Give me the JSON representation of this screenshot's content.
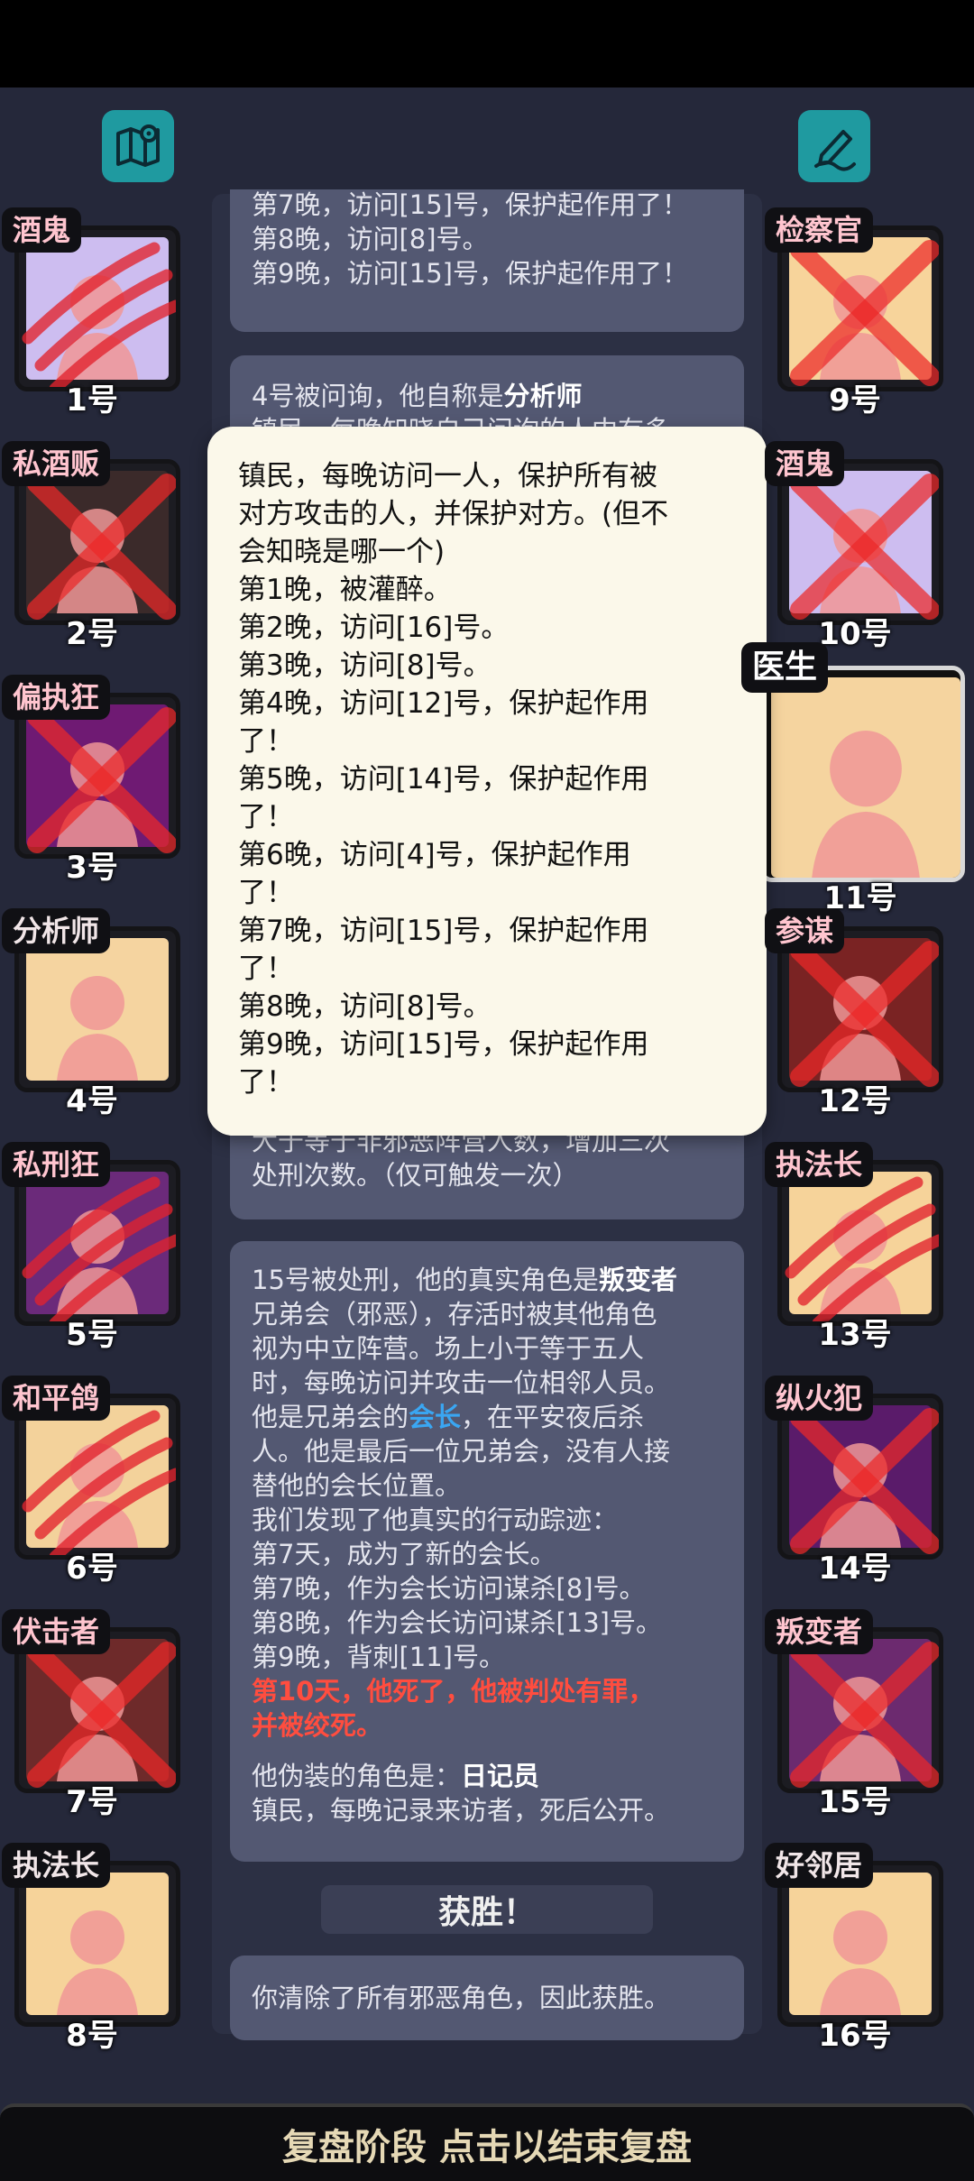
{
  "top_icons": {
    "left": "map-icon",
    "right": "pen-icon"
  },
  "left_players": [
    {
      "role": "酒鬼",
      "number": "1号",
      "bg": "#cdbdf0",
      "mark": "claw"
    },
    {
      "role": "私酒贩",
      "number": "2号",
      "bg": "#3b2a2a",
      "mark": "x"
    },
    {
      "role": "偏执狂",
      "number": "3号",
      "bg": "#6f1a73",
      "mark": "x"
    },
    {
      "role": "分析师",
      "number": "4号",
      "bg": "#f5d4a0",
      "mark": "none"
    },
    {
      "role": "私刑狂",
      "number": "5号",
      "bg": "#6b2a7a",
      "mark": "claw"
    },
    {
      "role": "和平鸽",
      "number": "6号",
      "bg": "#f3d29b",
      "mark": "claw"
    },
    {
      "role": "伏击者",
      "number": "7号",
      "bg": "#6e2a2a",
      "mark": "x"
    },
    {
      "role": "执法长",
      "number": "8号",
      "bg": "#f6d39a",
      "mark": "none"
    }
  ],
  "right_players": [
    {
      "role": "检察官",
      "number": "9号",
      "bg": "#f7d49b",
      "mark": "x"
    },
    {
      "role": "酒鬼",
      "number": "10号",
      "bg": "#cdbdf0",
      "mark": "x"
    },
    {
      "role": "医生",
      "number": "11号",
      "bg": "#f5d49f",
      "mark": "none",
      "active": true
    },
    {
      "role": "参谋",
      "number": "12号",
      "bg": "#7a2323",
      "mark": "x"
    },
    {
      "role": "执法长",
      "number": "13号",
      "bg": "#f6d39a",
      "mark": "claw"
    },
    {
      "role": "纵火犯",
      "number": "14号",
      "bg": "#5a1b6a",
      "mark": "x"
    },
    {
      "role": "叛变者",
      "number": "15号",
      "bg": "#6c2a6f",
      "mark": "x"
    },
    {
      "role": "好邻居",
      "number": "16号",
      "bg": "#f6d39a",
      "mark": "none"
    }
  ],
  "card1": {
    "lines": [
      "第7晚，访问[15]号，保护起作用了！",
      "第8晚，访问[8]号。",
      "第9晚，访问[15]号，保护起作用了！"
    ]
  },
  "card2": {
    "intro": "4号被问询，他自称是",
    "role": "分析师",
    "line2": "镇民，每晚知晓自己问询的人中有多",
    "tail1": "大于等于非邪恶阵营人数，增加三次",
    "tail2": "处刑次数。（仅可触发一次）"
  },
  "card3": {
    "intro": "15号被处刑，他的真实角色是",
    "role": "叛变者",
    "desc": [
      "兄弟会（邪恶），存活时被其他角色",
      "视为中立阵营。场上小于等于五人",
      "时，每晚访问并攻击一位相邻人员。"
    ],
    "desc2_pre": "他是兄弟会的",
    "desc2_link": "会长",
    "desc2_post": "，在平安夜后杀",
    "desc3": [
      "人。他是最后一位兄弟会，没有人接",
      "替他的会长位置。"
    ],
    "found": "我们发现了他真实的行动踪迹：",
    "trace": [
      "第7天，成为了新的会长。",
      "第7晚，作为会长访问谋杀[8]号。",
      "第8晚，作为会长访问谋杀[13]号。",
      "第9晚，背刺[11]号。"
    ],
    "death": [
      "第10天，他死了，他被判处有罪，",
      "并被绞死。"
    ],
    "disguise_pre": "他伪装的角色是：",
    "disguise_role": "日记员",
    "disguise_desc": "镇民，每晚记录来访者，死后公开。"
  },
  "win_banner": "获胜！",
  "card4": {
    "text": "你清除了所有邪恶角色，因此获胜。"
  },
  "tooltip": {
    "lines": [
      "镇民，每晚访问一人，保护所有被",
      "对方攻击的人，并保护对方。(但不",
      "会知晓是哪一个)",
      "第1晚，被灌醉。",
      "第2晚，访问[16]号。",
      "第3晚，访问[8]号。",
      "第4晚，访问[12]号，保护起作用",
      "了！",
      "第5晚，访问[14]号，保护起作用",
      "了！",
      "第6晚，访问[4]号，保护起作用",
      "了！",
      "第7晚，访问[15]号，保护起作用",
      "了！",
      "第8晚，访问[8]号。",
      "第9晚，访问[15]号，保护起作用",
      "了！"
    ]
  },
  "bottom_bar": "复盘阶段 点击以结束复盘"
}
